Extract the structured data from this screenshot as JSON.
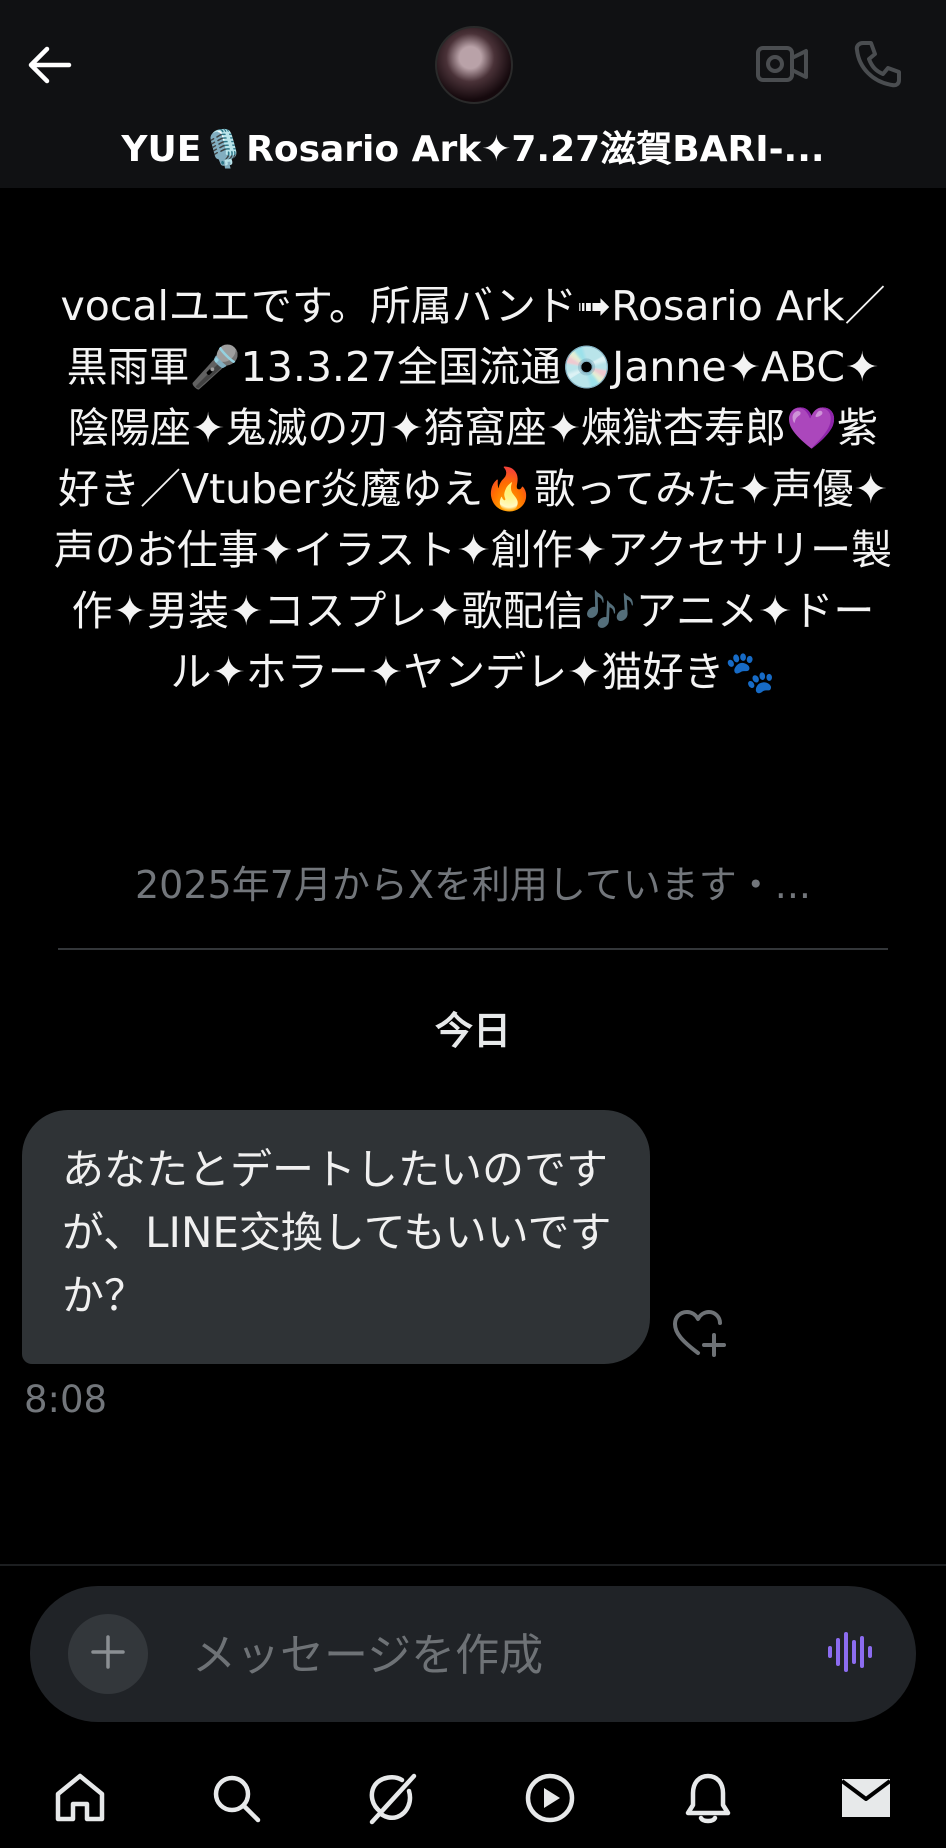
{
  "header": {
    "title": "YUE🎙️Rosario Ark✦7.27滋賀BARI-...",
    "back_icon": "arrow-left-icon",
    "video_icon": "video-camera-icon",
    "call_icon": "phone-icon"
  },
  "profile": {
    "bio": "vocalユエです。所属バンド➟Rosario Ark／黒雨軍🎤13.3.27全国流通💿Janne✦ABC✦陰陽座✦鬼滅の刃✦猗窩座✦煉獄杏寿郎💜紫好き／Vtuber炎魔ゆえ🔥歌ってみた✦声優✦声のお仕事✦イラスト✦創作✦アクセサリー製作✦男装✦コスプレ✦歌配信🎶アニメ✦ドール✦ホラー✦ヤンデレ✦猫好き🐾",
    "joined": "2025年7月からXを利用しています・..."
  },
  "conversation": {
    "date_separator": "今日",
    "messages": [
      {
        "text": "あなたとデートしたいのですが、LINE交換してもいいですか？",
        "time": "8:08"
      }
    ]
  },
  "composer": {
    "placeholder": "メッセージを作成",
    "add_icon": "plus-icon",
    "voice_icon": "voice-wave-icon"
  },
  "nav": [
    "home-icon",
    "search-icon",
    "grok-icon",
    "play-icon",
    "bell-icon",
    "mail-icon"
  ],
  "colors": {
    "background": "#000000",
    "header": "#101113",
    "bubble": "#2f3336",
    "muted_text": "#72767b",
    "accent_voice": "#8c6cf0"
  }
}
